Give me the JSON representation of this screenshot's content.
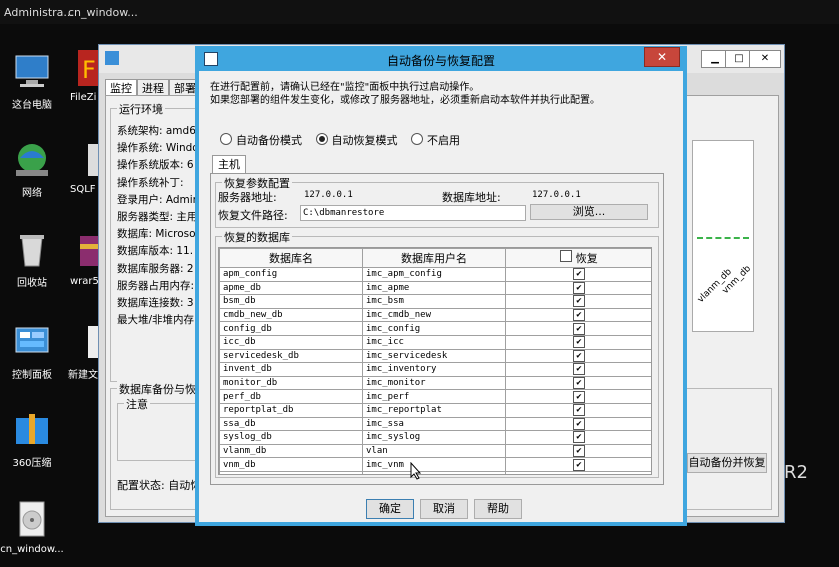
{
  "taskbar": {
    "items": [
      "Administra...",
      "cn_window..."
    ]
  },
  "desktop": {
    "icons": [
      {
        "label": "这台电脑",
        "icon": "computer-icon"
      },
      {
        "label": "网络",
        "icon": "network-icon"
      },
      {
        "label": "回收站",
        "icon": "recycle-bin-icon"
      },
      {
        "label": "控制面板",
        "icon": "control-panel-icon"
      },
      {
        "label": "360压缩",
        "icon": "archive-icon"
      },
      {
        "label": "cn_window...",
        "icon": "disc-icon"
      },
      {
        "label": "FileZi",
        "icon": "filezilla-icon"
      },
      {
        "label": "SQLF",
        "icon": "sql-icon"
      },
      {
        "label": "wrar5",
        "icon": "winrar-icon"
      },
      {
        "label": "新建文",
        "icon": "new-file-icon"
      }
    ],
    "side_text": "R2"
  },
  "bg_window": {
    "tabs": [
      "监控",
      "进程",
      "部署"
    ],
    "section_runtime": "运行环境",
    "info_rows": [
      "系统架构: amd64",
      "操作系统: Windo",
      "操作系统版本: 6",
      "操作系统补丁:",
      "登录用户: Admin",
      "服务器类型: 主用",
      "数据库: Microso",
      "数据库版本: 11.",
      "数据库服务器: 2",
      "服务器占用内存:",
      "数据库连接数: 3",
      "最大堆/非堆内存"
    ],
    "section_backup": "数据库备份与恢复",
    "notice": "注意",
    "config_status": "配置状态: 自动恢",
    "right_button": "自动备份并恢复",
    "chart_ticks": [
      "vlanm_db",
      "vnm_db"
    ]
  },
  "dialog": {
    "title": "自动备份与恢复配置",
    "close": "✕",
    "intro_line1": "在进行配置前，请确认已经在\"监控\"面板中执行过启动操作。",
    "intro_line2": "如果您部署的组件发生变化，或修改了服务器地址，必须重新启动本软件并执行此配置。",
    "modes": [
      {
        "label": "自动备份模式",
        "selected": false
      },
      {
        "label": "自动恢复模式",
        "selected": true
      },
      {
        "label": "不启用",
        "selected": false
      }
    ],
    "tab_main": "主机",
    "group_params": "恢复参数配置",
    "server_label": "服务器地址:",
    "server_value": "127.0.0.1",
    "db_label": "数据库地址:",
    "db_value": "127.0.0.1",
    "restore_path_label": "恢复文件路径:",
    "restore_path_value": "C:\\dbmanrestore",
    "browse": "浏览...",
    "group_dbs": "恢复的数据库",
    "columns": [
      "数据库名",
      "数据库用户名",
      "恢复"
    ],
    "rows": [
      {
        "db": "apm_config",
        "user": "imc_apm_config"
      },
      {
        "db": "apme_db",
        "user": "imc_apme"
      },
      {
        "db": "bsm_db",
        "user": "imc_bsm"
      },
      {
        "db": "cmdb_new_db",
        "user": "imc_cmdb_new"
      },
      {
        "db": "config_db",
        "user": "imc_config"
      },
      {
        "db": "icc_db",
        "user": "imc_icc"
      },
      {
        "db": "servicedesk_db",
        "user": "imc_servicedesk"
      },
      {
        "db": "invent_db",
        "user": "imc_inventory"
      },
      {
        "db": "monitor_db",
        "user": "imc_monitor"
      },
      {
        "db": "perf_db",
        "user": "imc_perf"
      },
      {
        "db": "reportplat_db",
        "user": "imc_reportplat"
      },
      {
        "db": "ssa_db",
        "user": "imc_ssa"
      },
      {
        "db": "syslog_db",
        "user": "imc_syslog"
      },
      {
        "db": "vlanm_db",
        "user": "vlan"
      },
      {
        "db": "vnm_db",
        "user": "imc_vnm"
      }
    ],
    "ok": "确定",
    "cancel": "取消",
    "help": "帮助"
  },
  "colors": {
    "dialog_accent": "#3fa6df",
    "close_red": "#c7463b",
    "desktop_bg": "#0b0b0b"
  }
}
